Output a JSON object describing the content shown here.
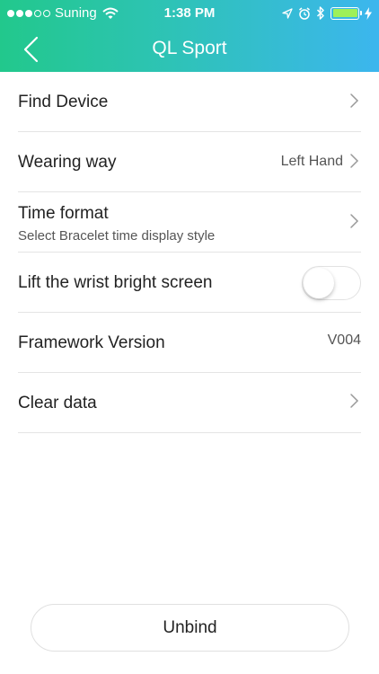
{
  "status_bar": {
    "carrier": "Suning",
    "time": "1:38 PM",
    "signal_filled": 3,
    "signal_total": 5,
    "battery_color": "#9ef05a"
  },
  "nav": {
    "title": "QL Sport",
    "back_icon": "chevron-left-icon"
  },
  "settings": {
    "find_device": {
      "label": "Find Device"
    },
    "wearing_way": {
      "label": "Wearing way",
      "value": "Left Hand"
    },
    "time_format": {
      "label": "Time format",
      "subtitle": "Select Bracelet time display style"
    },
    "lift_wrist": {
      "label": "Lift the wrist bright screen",
      "enabled": false
    },
    "framework_version": {
      "label": "Framework Version",
      "value": "V004"
    },
    "clear_data": {
      "label": "Clear data"
    }
  },
  "unbind": {
    "label": "Unbind"
  },
  "colors": {
    "header_start": "#22c88c",
    "header_end": "#3cb6ee"
  }
}
